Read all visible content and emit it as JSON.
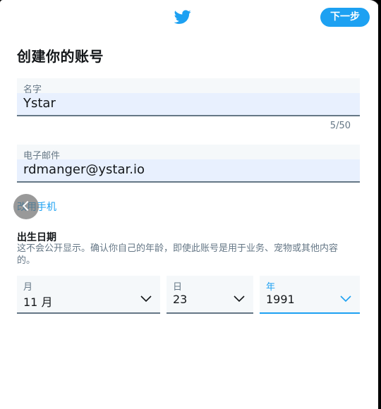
{
  "header": {
    "next_label": "下一步",
    "logo_icon": "twitter-bird-icon"
  },
  "page_title": "创建你的账号",
  "name_field": {
    "label": "名字",
    "value": "Ystar",
    "counter": "5/50"
  },
  "email_field": {
    "label": "电子邮件",
    "value": "rdmanger@ystar.io"
  },
  "use_phone_link": "改用手机",
  "dob": {
    "title": "出生日期",
    "description": "这不会公开显示。确认你自己的年龄，即使此账号是用于业务、宠物或其他内容的。",
    "month": {
      "label": "月",
      "value": "11 月"
    },
    "day": {
      "label": "日",
      "value": "23"
    },
    "year": {
      "label": "年",
      "value": "1991"
    }
  },
  "colors": {
    "accent": "#1da1f2",
    "text": "#14171a",
    "muted": "#657786",
    "autofill": "#e8f0fe"
  }
}
